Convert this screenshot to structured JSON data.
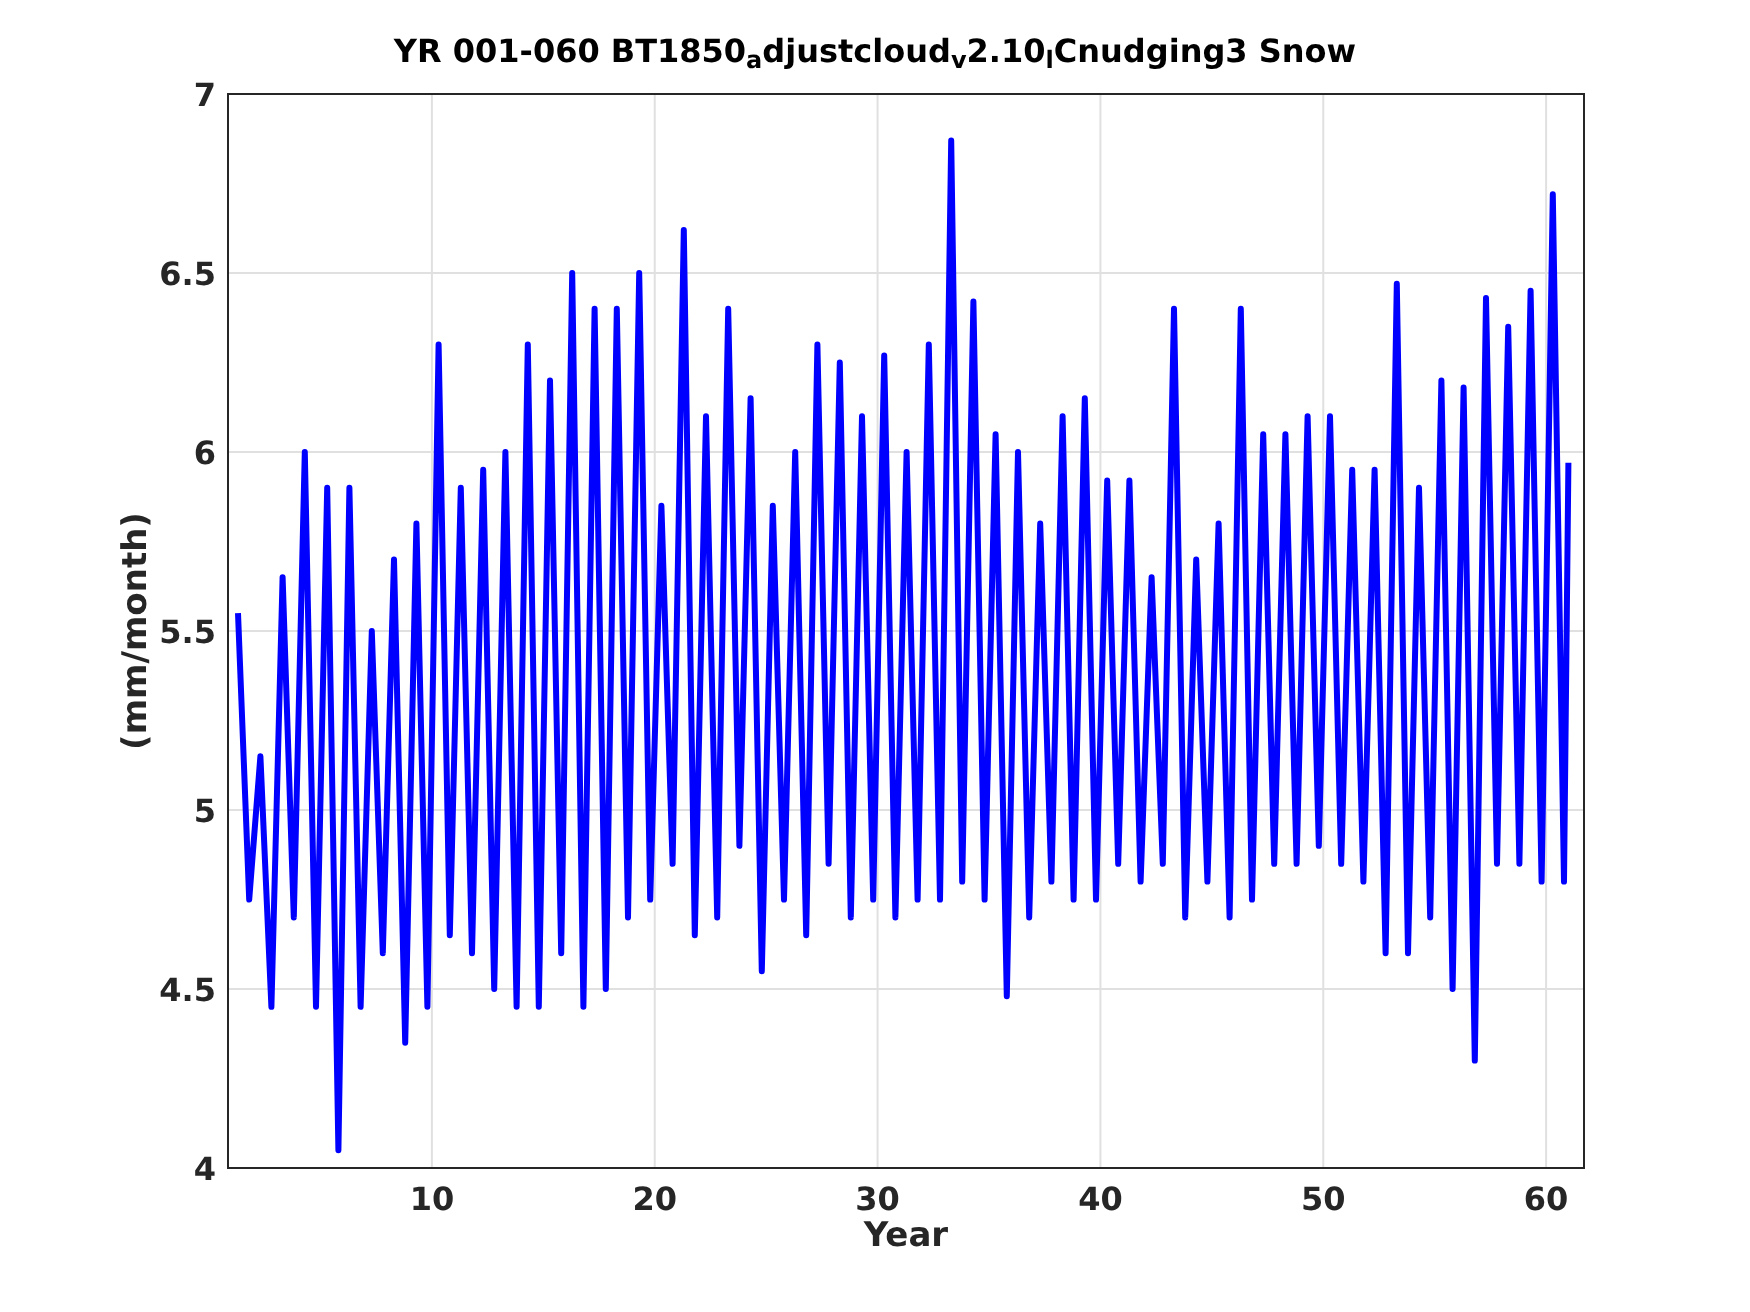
{
  "figure": {
    "title": "YR 001-060 BT1850$_{a}$djustcloud$_{v}$2.10$_{l}$Cnudging3 Snow",
    "chart_data": {
      "type": "line",
      "grid": true,
      "xlabel": "Year",
      "ylabel": "(mm/month)",
      "xlim": [
        0.85,
        61.7
      ],
      "ylim": [
        4,
        7
      ],
      "xticks": [
        10,
        20,
        30,
        40,
        50,
        60
      ],
      "yticks": [
        7,
        6.5,
        6,
        5.5,
        5,
        4.5,
        4
      ],
      "x": [
        1.3,
        1.8,
        2.3,
        2.8,
        3.3,
        3.8,
        4.3,
        4.8,
        5.3,
        5.8,
        6.3,
        6.8,
        7.3,
        7.8,
        8.3,
        8.8,
        9.3,
        9.8,
        10.3,
        10.8,
        11.3,
        11.8,
        12.3,
        12.8,
        13.3,
        13.8,
        14.3,
        14.8,
        15.3,
        15.8,
        16.3,
        16.8,
        17.3,
        17.8,
        18.3,
        18.8,
        19.3,
        19.8,
        20.3,
        20.8,
        21.3,
        21.8,
        22.3,
        22.8,
        23.3,
        23.8,
        24.3,
        24.8,
        25.3,
        25.8,
        26.3,
        26.8,
        27.3,
        27.8,
        28.3,
        28.8,
        29.3,
        29.8,
        30.3,
        30.8,
        31.3,
        31.8,
        32.3,
        32.8,
        33.3,
        33.8,
        34.3,
        34.8,
        35.3,
        35.8,
        36.3,
        36.8,
        37.3,
        37.8,
        38.3,
        38.8,
        39.3,
        39.8,
        40.3,
        40.8,
        41.3,
        41.8,
        42.3,
        42.8,
        43.3,
        43.8,
        44.3,
        44.8,
        45.3,
        45.8,
        46.3,
        46.8,
        47.3,
        47.8,
        48.3,
        48.8,
        49.3,
        49.8,
        50.3,
        50.8,
        51.3,
        51.8,
        52.3,
        52.8,
        53.3,
        53.8,
        54.3,
        54.8,
        55.3,
        55.8,
        56.3,
        56.8,
        57.3,
        57.8,
        58.3,
        58.8,
        59.3,
        59.8,
        60.3,
        60.8,
        61
      ],
      "series": [
        {
          "color": "#0000ff",
          "values": [
            5.55,
            4.75,
            5.15,
            4.45,
            5.65,
            4.7,
            6.0,
            4.45,
            5.9,
            4.05,
            5.9,
            4.45,
            5.5,
            4.6,
            5.7,
            4.35,
            5.8,
            4.45,
            6.3,
            4.65,
            5.9,
            4.6,
            5.95,
            4.5,
            6.0,
            4.45,
            6.3,
            4.45,
            6.2,
            4.6,
            6.5,
            4.45,
            6.4,
            4.5,
            6.4,
            4.7,
            6.5,
            4.75,
            5.85,
            4.85,
            6.62,
            4.65,
            6.1,
            4.7,
            6.4,
            4.9,
            6.15,
            4.55,
            5.85,
            4.75,
            6.0,
            4.65,
            6.3,
            4.85,
            6.25,
            4.7,
            6.1,
            4.75,
            6.27,
            4.7,
            6.0,
            4.75,
            6.3,
            4.75,
            6.87,
            4.8,
            6.42,
            4.75,
            6.05,
            4.48,
            6.0,
            4.7,
            5.8,
            4.8,
            6.1,
            4.75,
            6.15,
            4.75,
            5.92,
            4.85,
            5.92,
            4.8,
            5.65,
            4.85,
            6.4,
            4.7,
            5.7,
            4.8,
            5.8,
            4.7,
            6.4,
            4.75,
            6.05,
            4.85,
            6.05,
            4.85,
            6.1,
            4.9,
            6.1,
            4.85,
            5.95,
            4.8,
            5.95,
            4.6,
            6.47,
            4.6,
            5.9,
            4.7,
            6.2,
            4.5,
            6.18,
            4.3,
            6.43,
            4.85,
            6.35,
            4.85,
            6.45,
            4.8,
            6.72,
            4.8,
            5.97
          ]
        }
      ]
    }
  }
}
